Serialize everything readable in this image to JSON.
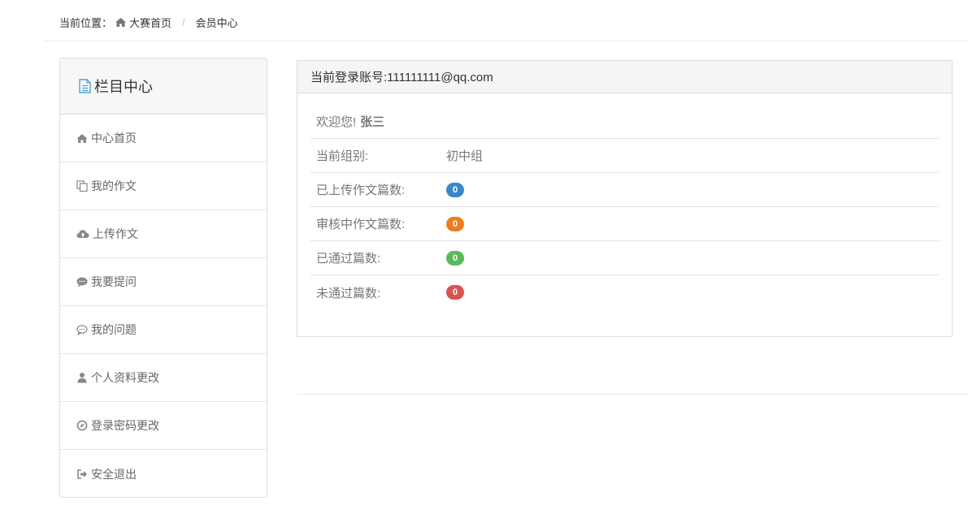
{
  "breadcrumb": {
    "prefix": "当前位置：",
    "home": "大赛首页",
    "separator": "/",
    "current": "会员中心"
  },
  "sidebar": {
    "title": "栏目中心",
    "items": [
      {
        "label": "中心首页",
        "icon": "home-icon"
      },
      {
        "label": "我的作文",
        "icon": "copy-icon"
      },
      {
        "label": "上传作文",
        "icon": "cloud-upload-icon"
      },
      {
        "label": "我要提问",
        "icon": "comment-icon"
      },
      {
        "label": "我的问题",
        "icon": "comment-outline-icon"
      },
      {
        "label": "个人资料更改",
        "icon": "user-icon"
      },
      {
        "label": "登录密码更改",
        "icon": "compass-icon"
      },
      {
        "label": "安全退出",
        "icon": "sign-out-icon"
      }
    ]
  },
  "panel": {
    "header": "当前登录账号:111111111@qq.com",
    "welcome_prefix": "欢迎您!",
    "welcome_name": "张三",
    "group_label": "当前组别:",
    "group_value": "初中组",
    "stats": [
      {
        "label": "已上传作文篇数:",
        "count": "0",
        "color": "#3a87c8"
      },
      {
        "label": "审核中作文篇数:",
        "count": "0",
        "color": "#ec7e1e"
      },
      {
        "label": "已通过篇数:",
        "count": "0",
        "color": "#5cb85c"
      },
      {
        "label": "未通过篇数:",
        "count": "0",
        "color": "#d9534f"
      }
    ]
  }
}
